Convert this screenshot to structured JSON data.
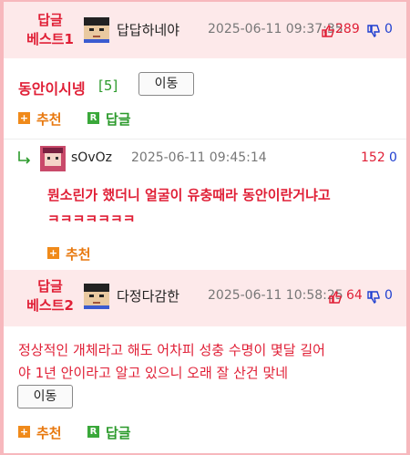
{
  "post1": {
    "best_label": "답글\n베스트1",
    "nickname": "답답하네야",
    "date": "2025-06-11 09:37:35",
    "likes": "289",
    "dislikes": "0",
    "title": "동안이시넹",
    "count": "[5]",
    "move_label": "이동",
    "recommend_label": "추천",
    "reply_label": "답글"
  },
  "reply1": {
    "nickname": "sOvOz",
    "date": "2025-06-11 09:45:14",
    "likes": "152",
    "dislikes": "0",
    "text_line1": "뭔소린가 했더니 얼굴이 유충때라 동안이란거냐고",
    "text_line2": "ㅋㅋㅋㅋㅋㅋㅋ",
    "recommend_label": "추천"
  },
  "post2": {
    "best_label": "답글\n베스트2",
    "nickname": "다정다감한",
    "date": "2025-06-11 10:58:25",
    "likes": "64",
    "dislikes": "0",
    "text_line1": "정상적인 개체라고 해도 어차피 성충 수명이 몇달 길어",
    "text_line2": "야 1년 안이라고 알고 있으니 오래 잘 산건 맞네",
    "move_label": "이동",
    "recommend_label": "추천",
    "reply_label": "답글"
  },
  "colors": {
    "accent_red": "#e01f36",
    "best_bg": "#fde9ea",
    "border_pink": "#f7b8bd",
    "like_red": "#e01f36",
    "dislike_blue": "#1f3fd0",
    "green": "#2b9a2b",
    "orange": "#e8790f"
  },
  "icons": {
    "avatar1": "pixel-avatar-icon",
    "avatar2": "anime-avatar-icon",
    "avatar3": "pixel-avatar-icon",
    "like": "thumb-up-icon",
    "dislike": "thumb-down-icon",
    "reply_arrow": "reply-arrow-icon",
    "recommend": "plus-icon",
    "reply": "r-icon"
  }
}
